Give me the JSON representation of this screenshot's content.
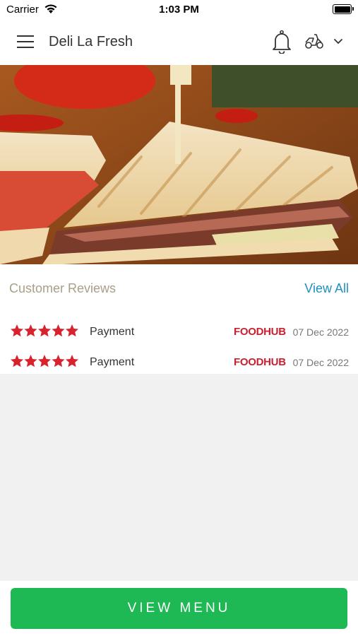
{
  "status_bar": {
    "carrier": "Carrier",
    "time": "1:03 PM"
  },
  "header": {
    "title": "Deli La Fresh"
  },
  "icons": {
    "menu": "hamburger-menu-icon",
    "notifications": "bell-icon",
    "delivery": "delivery-scooter-icon",
    "dropdown": "chevron-down-icon"
  },
  "reviews": {
    "title": "Customer Reviews",
    "view_all": "View All",
    "items": [
      {
        "rating": 5,
        "label": "Payment",
        "source": "FOODHUB",
        "date": "07 Dec 2022"
      },
      {
        "rating": 5,
        "label": "Payment",
        "source": "FOODHUB",
        "date": "07 Dec 2022"
      }
    ]
  },
  "cta": {
    "label": "VIEW MENU"
  },
  "colors": {
    "accent_green": "#1eb954",
    "link_blue": "#1f8fc2",
    "star_red": "#d8232f",
    "foodhub_red": "#c8202f"
  }
}
